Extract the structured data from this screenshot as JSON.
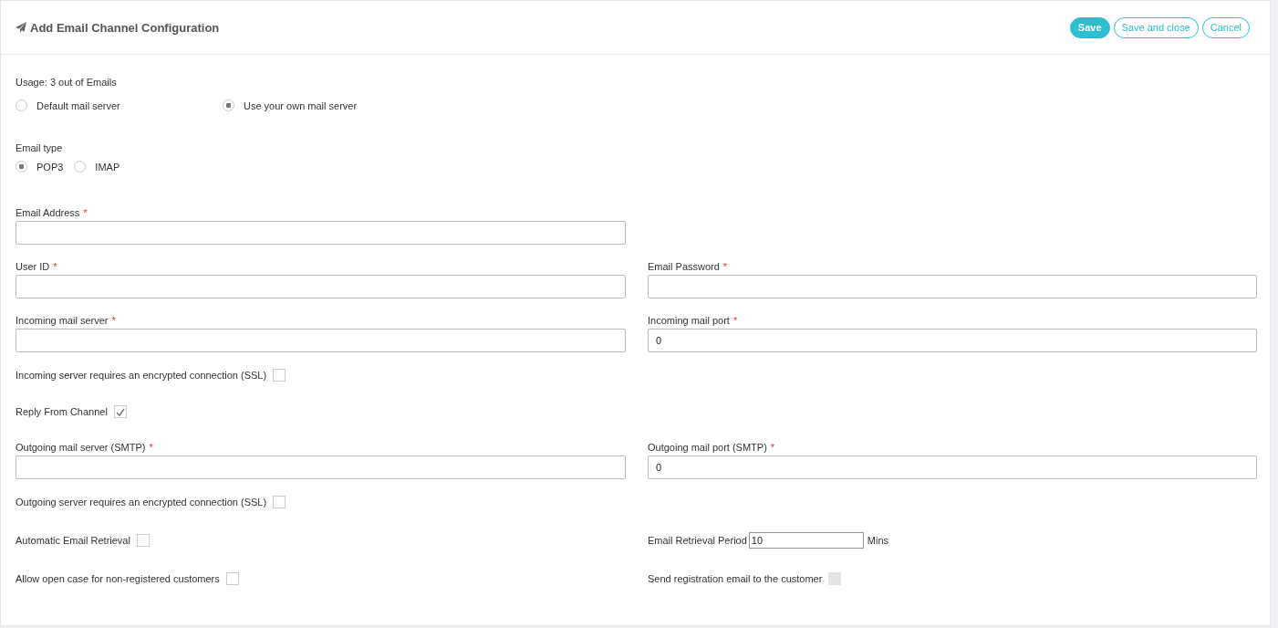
{
  "header": {
    "title": "Add Email Channel Configuration",
    "buttons": [
      {
        "label": "Save",
        "kind": "primary"
      },
      {
        "label": "Save and close",
        "kind": "outline"
      },
      {
        "label": "Cancel",
        "kind": "outline"
      }
    ]
  },
  "usage": "Usage: 3 out of Emails",
  "server_options": [
    {
      "label": "Default mail server",
      "selected": false
    },
    {
      "label": "Use your own mail server",
      "selected": true
    }
  ],
  "email_type": {
    "label": "Email type",
    "options": [
      {
        "label": "POP3",
        "selected": true
      },
      {
        "label": "IMAP",
        "selected": false
      }
    ]
  },
  "rows": [
    {
      "left": {
        "kind": "field",
        "label": "Email Address",
        "marker": "*"
      }
    },
    {
      "left": {
        "kind": "field",
        "label": "User ID",
        "marker": "*"
      },
      "right": {
        "kind": "field",
        "label": "Email Password",
        "marker": "*"
      }
    },
    {
      "left": {
        "kind": "field",
        "label": "Incoming mail server",
        "marker": "*"
      },
      "right": {
        "kind": "field",
        "label": "Incoming mail port",
        "marker": "*",
        "value": "0"
      }
    },
    {
      "left": {
        "kind": "checkbox",
        "label": "Incoming server requires an encrypted connection (SSL)",
        "checked": false,
        "disabled": false
      }
    },
    {
      "left": {
        "kind": "checkbox",
        "label": "Reply From Channel",
        "checked": true,
        "disabled": false
      }
    },
    {
      "left": {
        "kind": "field",
        "label": "Outgoing mail server (SMTP)",
        "marker": "*"
      },
      "right": {
        "kind": "field",
        "label": "Outgoing mail port (SMTP)",
        "marker": "*",
        "value": "0"
      }
    },
    {
      "left": {
        "kind": "checkbox",
        "label": "Outgoing server requires an encrypted connection (SSL)",
        "checked": false,
        "disabled": false
      }
    },
    {
      "left": {
        "kind": "checkbox",
        "label": "Automatic Email Retrieval",
        "checked": false,
        "disabled": false
      },
      "right": {
        "kind": "inline-field",
        "label": "Email Retrieval Period",
        "value": "10",
        "unit": "Mins"
      }
    },
    {
      "left": {
        "kind": "checkbox",
        "label": "Allow open case for non-registered customers",
        "checked": false,
        "disabled": false
      },
      "right": {
        "kind": "checkbox",
        "label": "Send registration email to the customer",
        "checked": false,
        "disabled": true
      }
    }
  ]
}
